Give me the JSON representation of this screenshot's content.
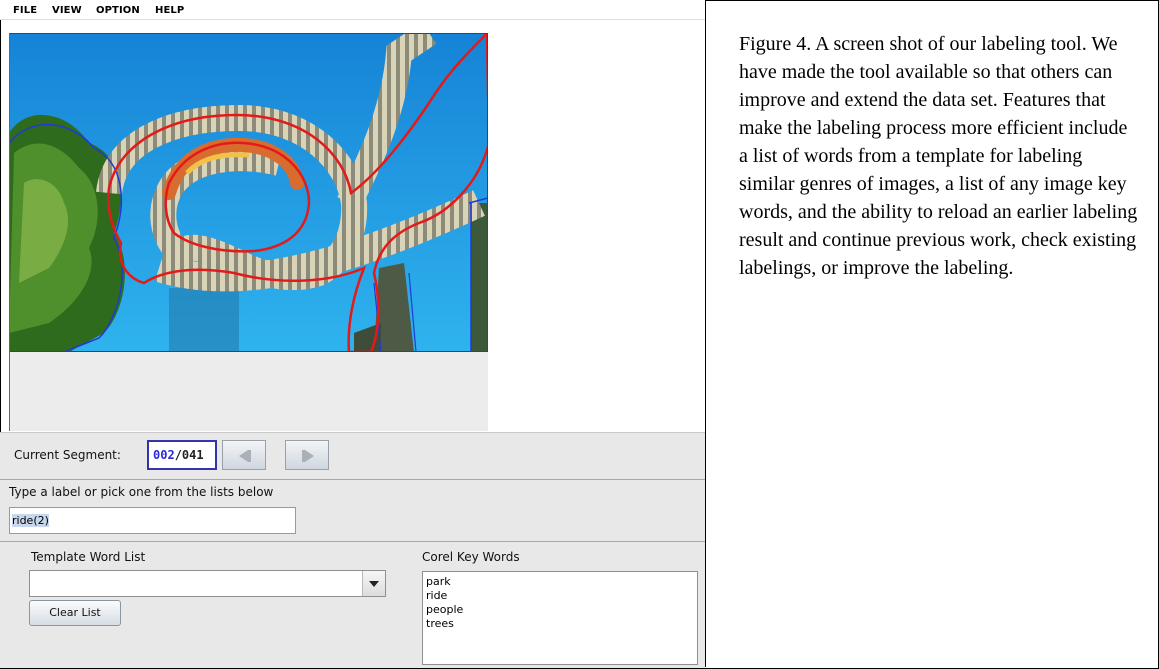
{
  "menu": {
    "file": "FILE",
    "view": "VIEW",
    "option": "OPTION",
    "help": "HELP"
  },
  "segment": {
    "label": "Current Segment:",
    "current": "002",
    "separator": "/",
    "total": "041"
  },
  "label_entry": {
    "prompt": "Type a label or pick one from the lists below",
    "value": "ride(2)"
  },
  "template": {
    "title": "Template Word List",
    "selected": "",
    "clear_label": "Clear List"
  },
  "corel": {
    "title": "Corel Key Words",
    "items": [
      "park",
      "ride",
      "people",
      "trees"
    ]
  },
  "caption": "Figure 4. A screen shot of our labeling tool. We have made the tool available so that others can improve and extend the data set. Features that make the labeling process more efficient include a list of words from a template for labeling similar genres of images, a list of any image key words, and the ability to reload an earlier labeling result and continue previous work, check existing labelings, or improve the labeling.",
  "colors": {
    "segment_outline": "#e41a1a",
    "other_segments": "#1f3bd6",
    "sky": "#1a9be0",
    "segment_number": "#2b2bd8"
  }
}
